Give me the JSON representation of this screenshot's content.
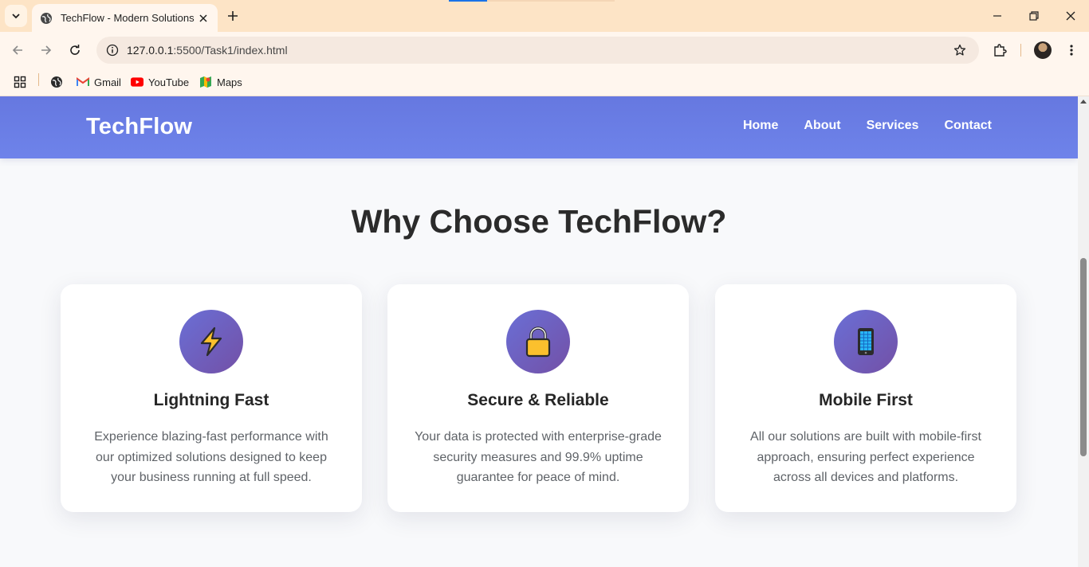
{
  "browser": {
    "tab_title": "TechFlow - Modern Solutions",
    "url_host": "127.0.0.1",
    "url_rest": ":5500/Task1/index.html",
    "bookmarks": [
      {
        "label": "Gmail",
        "icon": "gmail-icon"
      },
      {
        "label": "YouTube",
        "icon": "youtube-icon"
      },
      {
        "label": "Maps",
        "icon": "maps-icon"
      }
    ]
  },
  "site": {
    "logo": "TechFlow",
    "nav": [
      "Home",
      "About",
      "Services",
      "Contact"
    ],
    "section_title": "Why Choose TechFlow?",
    "features": [
      {
        "icon": "lightning-icon",
        "title": "Lightning Fast",
        "text": "Experience blazing-fast performance with our optimized solutions designed to keep your business running at full speed."
      },
      {
        "icon": "lock-icon",
        "title": "Secure & Reliable",
        "text": "Your data is protected with enterprise-grade security measures and 99.9% uptime guarantee for peace of mind."
      },
      {
        "icon": "mobile-phone-icon",
        "title": "Mobile First",
        "text": "All our solutions are built with mobile-first approach, ensuring perfect experience across all devices and platforms."
      }
    ]
  },
  "colors": {
    "navbar": "#6678e0",
    "icon_gradient_start": "#6a6fd6",
    "icon_gradient_end": "#7350a6",
    "tabstrip": "#fde4c6",
    "page_bg": "#f8f9fb"
  }
}
